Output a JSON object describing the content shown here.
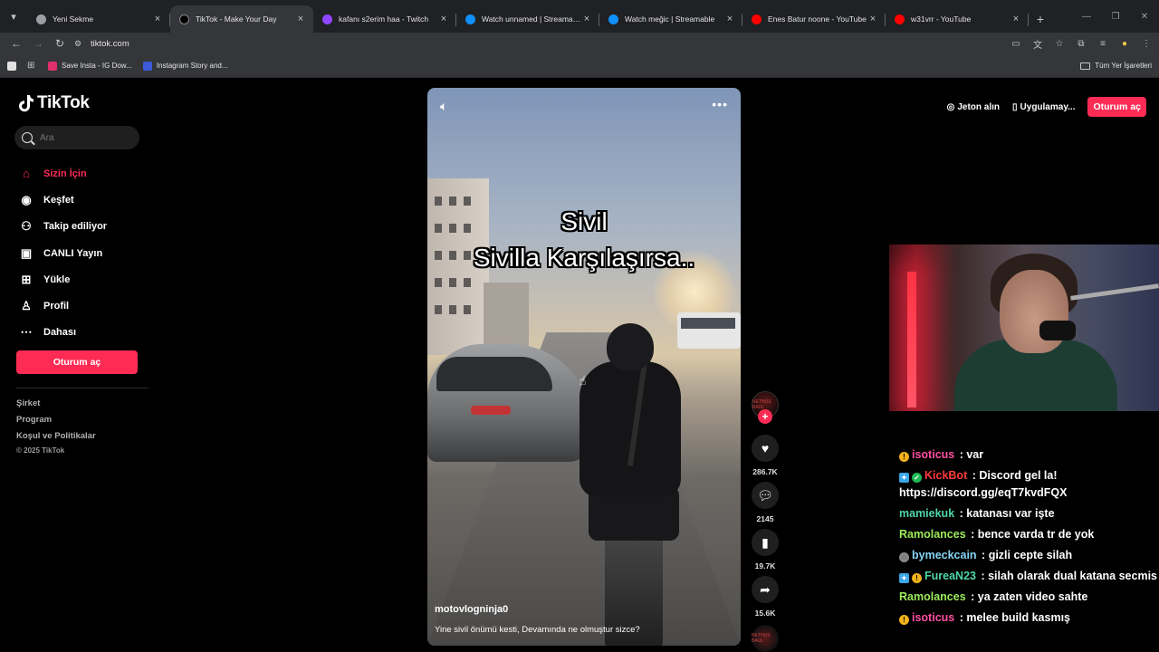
{
  "browser": {
    "tabs": [
      {
        "title": "Yeni Sekme",
        "favicon_color": "#9aa0a6",
        "active": false
      },
      {
        "title": "TikTok - Make Your Day",
        "favicon_color": "#000000",
        "active": true
      },
      {
        "title": "kafanı s2erim haa - Twitch",
        "favicon_color": "#9146ff",
        "active": false
      },
      {
        "title": "Watch unnamed | Streamable",
        "favicon_color": "#0f90fa",
        "active": false
      },
      {
        "title": "Watch meğic | Streamable",
        "favicon_color": "#0f90fa",
        "active": false
      },
      {
        "title": "Enes Batur noone - YouTube",
        "favicon_color": "#ff0000",
        "active": false
      },
      {
        "title": "w31vrr - YouTube",
        "favicon_color": "#ff0000",
        "active": false
      }
    ],
    "url": "tiktok.com",
    "bookmarks": [
      {
        "label": "Save Insta - IG Dow...",
        "color": "#e1306c"
      },
      {
        "label": "Instagram Story and...",
        "color": "#3b5bdb"
      }
    ],
    "all_bookmarks_label": "Tüm Yer İşaretleri"
  },
  "tiktok": {
    "logo_text": "TikTok",
    "search_placeholder": "Ara",
    "nav": [
      {
        "label": "Sizin İçin",
        "icon": "home-icon",
        "active": true
      },
      {
        "label": "Keşfet",
        "icon": "compass-icon",
        "active": false
      },
      {
        "label": "Takip ediliyor",
        "icon": "following-icon",
        "active": false
      },
      {
        "label": "CANLI Yayın",
        "icon": "live-icon",
        "active": false
      },
      {
        "label": "Yükle",
        "icon": "upload-icon",
        "active": false
      },
      {
        "label": "Profil",
        "icon": "profile-icon",
        "active": false
      },
      {
        "label": "Dahası",
        "icon": "more-icon",
        "active": false
      }
    ],
    "login_label": "Oturum aç",
    "footer": [
      "Şirket",
      "Program",
      "Koşul ve Politikalar"
    ],
    "copyright": "© 2025 TikTok",
    "topbar": {
      "coins_label": "Jeton alın",
      "app_label": "Uygulamay...",
      "login_label": "Oturum aç"
    },
    "video": {
      "caption_line1": "Sivil",
      "caption_line2": "Sivilla Karşılaşırsa..",
      "author": "motovlogninja0",
      "description": "Yine sivil önümü kesti, Devamında ne olmuştur sizce?",
      "likes": "286.7K",
      "comments": "2145",
      "saves": "19.7K",
      "shares": "15.6K",
      "avatar_text": "NETHUS BAUL"
    }
  },
  "chat": [
    {
      "badges": [
        "gold"
      ],
      "user": "isoticus",
      "user_color": "#ff4fa3",
      "message": "var"
    },
    {
      "badges": [
        "prime",
        "check"
      ],
      "user": "KickBot",
      "user_color": "#ff3b3b",
      "message": "Discord gel la! https://discord.gg/eqT7kvdFQX"
    },
    {
      "badges": [],
      "user": "mamiekuk",
      "user_color": "#4fd6a6",
      "message": "katanası var işte"
    },
    {
      "badges": [],
      "user": "Ramolances",
      "user_color": "#9dea5c",
      "message": "bence varda tr de yok"
    },
    {
      "badges": [
        "grey"
      ],
      "user": "bymeckcain",
      "user_color": "#86d4f5",
      "message": "gizli cepte silah"
    },
    {
      "badges": [
        "prime",
        "gold"
      ],
      "user": "FureaN23",
      "user_color": "#4fd6a6",
      "message": "silah olarak dual katana secmis"
    },
    {
      "badges": [],
      "user": "Ramolances",
      "user_color": "#9dea5c",
      "message": "ya zaten video sahte"
    },
    {
      "badges": [
        "gold"
      ],
      "user": "isoticus",
      "user_color": "#ff4fa3",
      "message": "melee build kasmış"
    }
  ],
  "colors": {
    "accent": "#fe2c55",
    "chrome_bg": "#202124",
    "toolbar_bg": "#35363a"
  }
}
